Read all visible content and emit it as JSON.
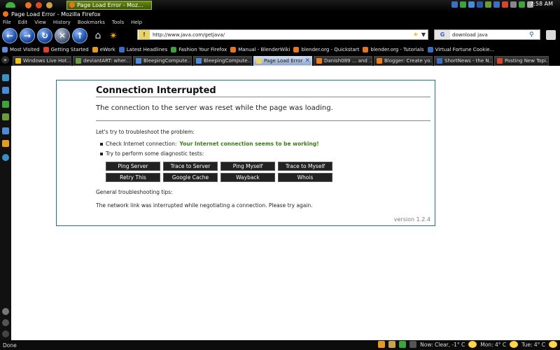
{
  "taskbar": {
    "task_label": "Page Load Error - Moz...",
    "clock": "7:58 AM"
  },
  "window": {
    "title": "Page Load Error - Mozilla Firefox"
  },
  "menu": [
    "File",
    "Edit",
    "View",
    "History",
    "Bookmarks",
    "Tools",
    "Help"
  ],
  "nav": {
    "url": "http://www.java.com/getjava/",
    "search_value": "download java",
    "search_engine": "G"
  },
  "bookmarks": [
    {
      "label": "Most Visited",
      "color": "#5f8dd3"
    },
    {
      "label": "Getting Started",
      "color": "#d9442b"
    },
    {
      "label": "eWork",
      "color": "#e39a1f"
    },
    {
      "label": "Latest Headlines",
      "color": "#3b6fc4"
    },
    {
      "label": "Fashion Your Firefox",
      "color": "#3da33d"
    },
    {
      "label": "Manual - BlenderWiki",
      "color": "#e8741b"
    },
    {
      "label": "blender.org - Quickstart",
      "color": "#e8741b"
    },
    {
      "label": "blender.org - Tutorials",
      "color": "#e8741b"
    },
    {
      "label": "Virtual Fortune Cookie...",
      "color": "#3b6fc4"
    }
  ],
  "tabs": [
    {
      "label": "Windows Live Hot...",
      "color": "#f0c419",
      "active": false
    },
    {
      "label": "deviantART: wher...",
      "color": "#6a9b3c",
      "active": false
    },
    {
      "label": "BleepingCompute...",
      "color": "#4b8ad6",
      "active": false
    },
    {
      "label": "BleepingCompute...",
      "color": "#4b8ad6",
      "active": false
    },
    {
      "label": "Page Load Error",
      "color": "#e9d46a",
      "active": true
    },
    {
      "label": "Danish089 ... and ...",
      "color": "#f07c1a",
      "active": false
    },
    {
      "label": "Blogger: Create yo...",
      "color": "#f07c1a",
      "active": false
    },
    {
      "label": "ShortNews - the N...",
      "color": "#3b6fc4",
      "active": false
    },
    {
      "label": "Posting New Topi...",
      "color": "#d9442b",
      "active": false
    }
  ],
  "error": {
    "title": "Connection Interrupted",
    "description": "The connection to the server was reset while the page was loading.",
    "troubleshoot_intro": "Let's try to troubleshoot the problem:",
    "check_label": "Check Internet connection:",
    "check_result": "Your Internet connection seems to be working!",
    "diag_label": "Try to perform some diagnostic tests:",
    "buttons": [
      "Ping Server",
      "Trace to Server",
      "Ping Myself",
      "Trace to Myself",
      "Retry This",
      "Google Cache",
      "Wayback",
      "Whois"
    ],
    "tips_label": "General troubleshooting tips:",
    "tip_text": "The network link was interrupted while negotiating a connection. Please try again.",
    "version": "version 1.2.4"
  },
  "status": {
    "text": "Done",
    "weather_now": "Now: Clear, -1° C",
    "weather_mon": "Mon: 4° C",
    "weather_tue": "Tue: 4° C"
  }
}
